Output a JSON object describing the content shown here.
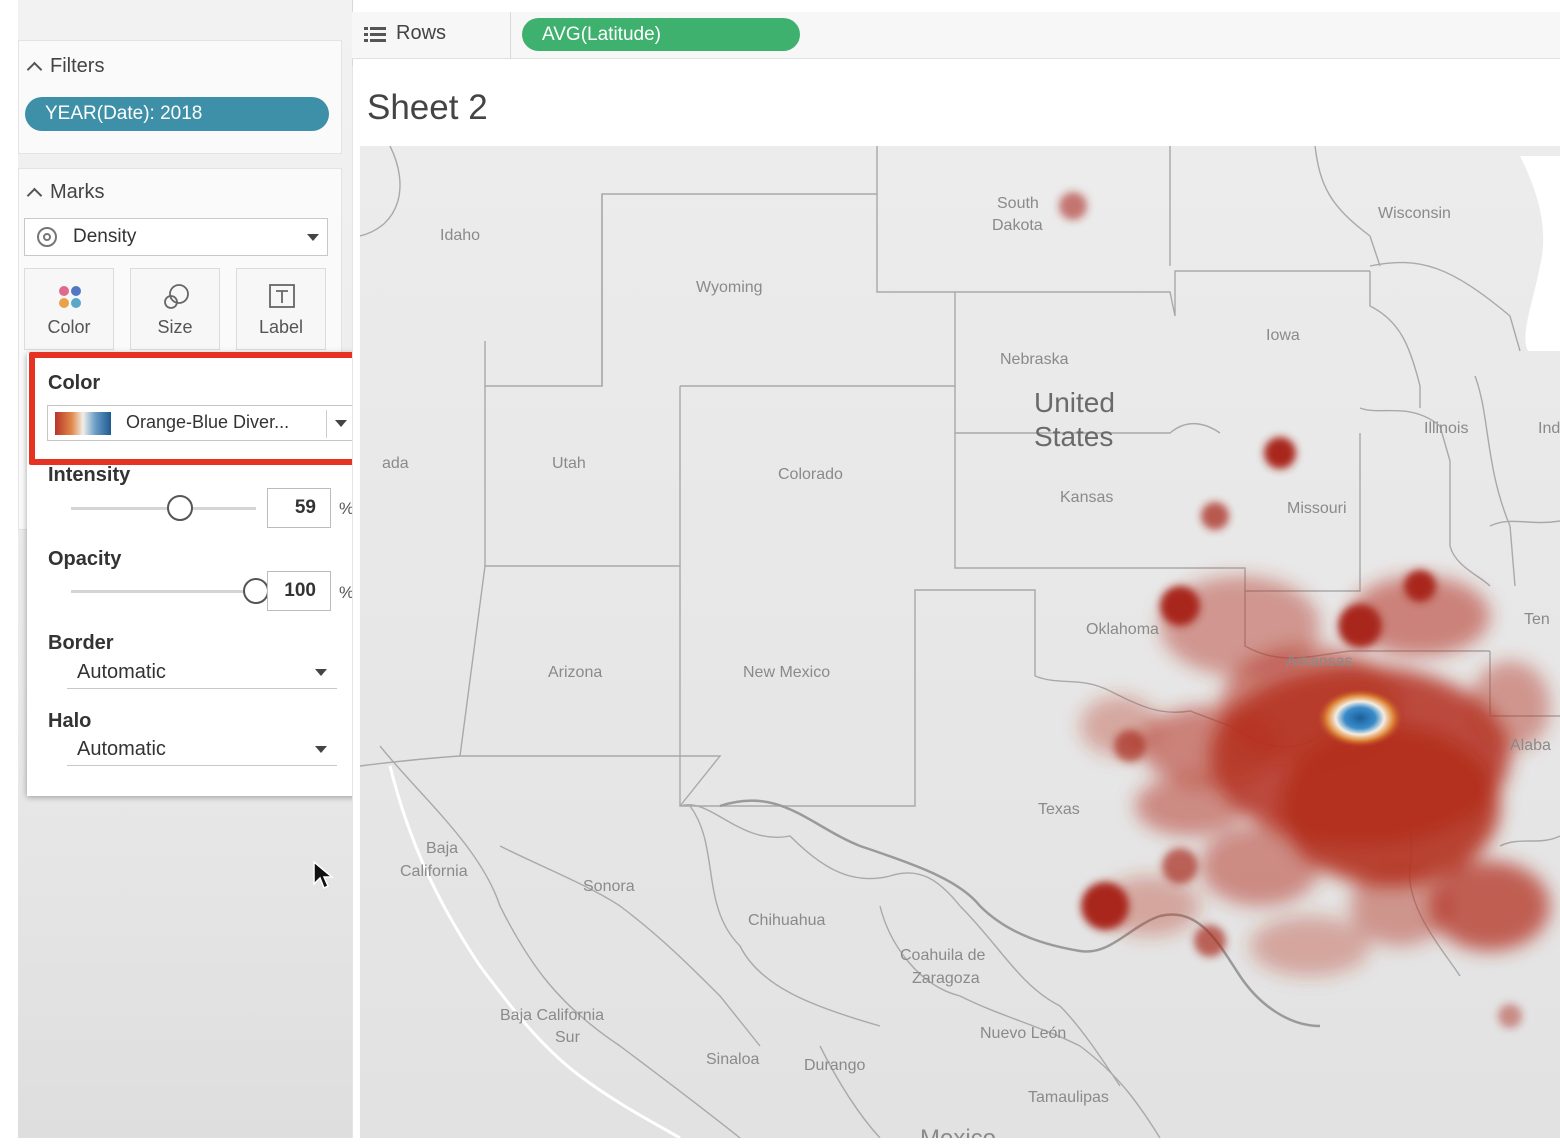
{
  "shelf": {
    "rows_label": "Rows",
    "rows_pill": "AVG(Latitude)"
  },
  "sheet": {
    "title": "Sheet 2"
  },
  "filters": {
    "title": "Filters",
    "pill": "YEAR(Date): 2018"
  },
  "marks": {
    "title": "Marks",
    "type": "Density",
    "buttons": [
      {
        "label": "Color",
        "icon": "color-dots-icon"
      },
      {
        "label": "Size",
        "icon": "size-icon"
      },
      {
        "label": "Label",
        "icon": "label-icon"
      }
    ]
  },
  "color_popup": {
    "color_label": "Color",
    "palette": "Orange-Blue Diver...",
    "intensity_label": "Intensity",
    "intensity_value": "59",
    "intensity_fraction": 0.59,
    "opacity_label": "Opacity",
    "opacity_value": "100",
    "opacity_fraction": 1.0,
    "percent": "%",
    "border_label": "Border",
    "border_value": "Automatic",
    "halo_label": "Halo",
    "halo_value": "Automatic"
  },
  "map": {
    "country_label": [
      "United",
      "States"
    ],
    "labels": [
      "Idaho",
      "Wyoming",
      "South",
      "Dakota",
      "Wisconsin",
      "Iowa",
      "Nebraska",
      "Illinois",
      "Ind",
      "Utah",
      "Colorado",
      "Kansas",
      "Missouri",
      "ada",
      "Oklahoma",
      "Arkansas",
      "Ten",
      "Arizona",
      "New Mexico",
      "Alaba",
      "Texas",
      "Baja",
      "California",
      "Sonora",
      "Chihuahua",
      "Coahuila de",
      "Zaragoza",
      "Baja California",
      "Sur",
      "Nuevo León",
      "Sinaloa",
      "Durango",
      "Tamaulipas",
      "Mexico"
    ]
  },
  "colors": {
    "filter_pill": "#3d90a8",
    "rows_pill": "#3fb16f",
    "highlight": "#e53222",
    "density_red": "#a8281c",
    "density_blue": "#1f6fb0"
  }
}
